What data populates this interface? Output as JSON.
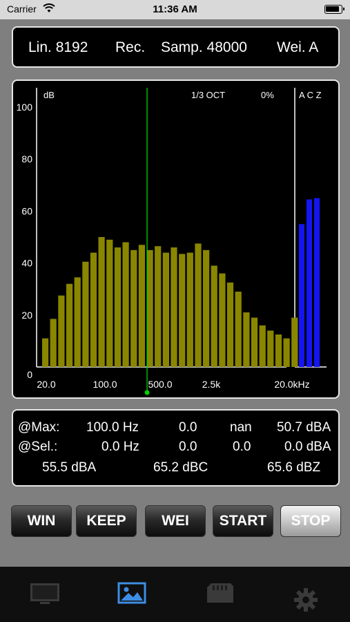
{
  "status": {
    "carrier": "Carrier",
    "time": "11:36 AM"
  },
  "info": {
    "lin": "Lin. 8192",
    "rec": "Rec.",
    "samp": "Samp. 48000",
    "wei": "Wei. A"
  },
  "colors": {
    "bars": "#8a8600",
    "weight_bars": "#1515f2",
    "cursor": "#00d000",
    "panel_border": "#e6e6e6"
  },
  "chart_data": {
    "type": "bar",
    "header": {
      "unit": "dB",
      "band": "1/3 OCT",
      "percent": "0%",
      "weights": "A C Z"
    },
    "yticks": [
      0,
      20,
      40,
      60,
      80,
      100
    ],
    "ylim": [
      0,
      100
    ],
    "xtick_labels": [
      "20.0",
      "100.0",
      "500.0",
      "2.5k",
      "20.0kHz"
    ],
    "values": [
      11,
      18.5,
      27.5,
      32,
      34.5,
      40.5,
      44,
      50,
      49,
      46,
      48,
      45,
      47,
      45,
      46.5,
      44,
      46,
      43.5,
      44,
      47.5,
      45,
      39,
      36,
      32.5,
      29,
      21,
      19,
      16,
      14,
      12.5,
      11,
      19
    ],
    "cursor_band_index": 13,
    "weight_series": [
      {
        "name": "A",
        "value": 55
      },
      {
        "name": "C",
        "value": 64.5
      },
      {
        "name": "Z",
        "value": 65
      }
    ]
  },
  "readout": {
    "max_label": "@Max:",
    "max_freq": "100.0 Hz",
    "max_v1": "0.0",
    "max_v2": "nan",
    "max_level": "50.7 dBA",
    "sel_label": "@Sel.:",
    "sel_freq": "0.0 Hz",
    "sel_v1": "0.0",
    "sel_v2": "0.0",
    "sel_level": "0.0 dBA",
    "leq_a": "55.5 dBA",
    "leq_c": "65.2 dBC",
    "leq_z": "65.6 dBZ"
  },
  "buttons": {
    "win": "WIN",
    "keep": "KEEP",
    "wei": "WEI",
    "start": "START",
    "stop": "STOP"
  },
  "tabs": [
    {
      "icon": "monitor-icon",
      "selected": false
    },
    {
      "icon": "image-icon",
      "selected": true
    },
    {
      "icon": "sd-card-icon",
      "selected": false
    },
    {
      "icon": "gear-icon",
      "selected": false
    }
  ]
}
